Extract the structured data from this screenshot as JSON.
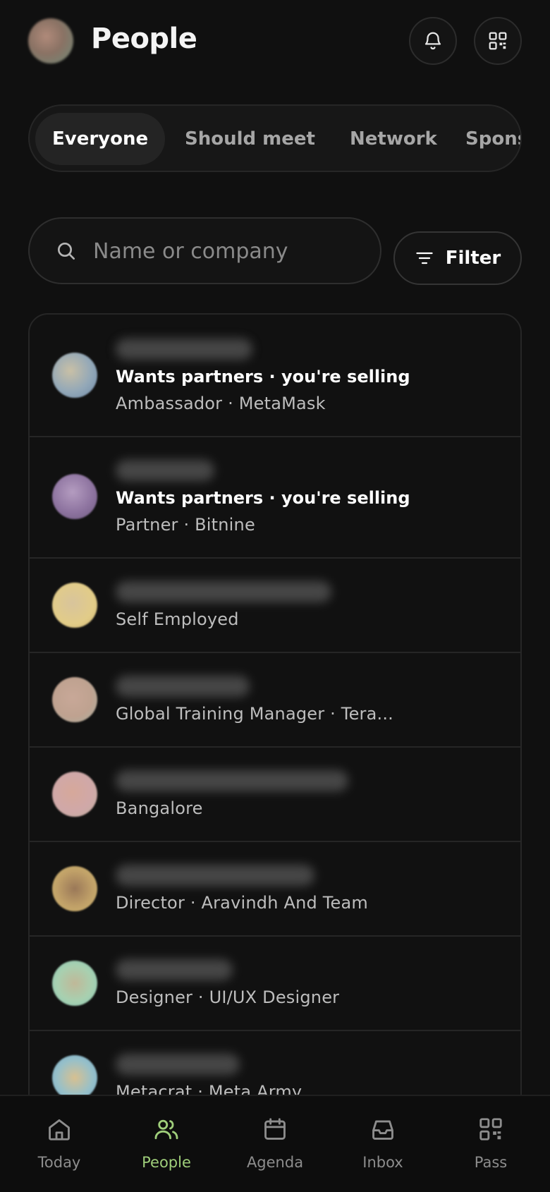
{
  "header": {
    "title": "People"
  },
  "tabs": [
    {
      "label": "Everyone",
      "active": true
    },
    {
      "label": "Should meet"
    },
    {
      "label": "Network"
    },
    {
      "label": "Sponsors"
    }
  ],
  "search": {
    "placeholder": "Name or company",
    "value": ""
  },
  "filter": {
    "label": "Filter"
  },
  "people": [
    {
      "intent": "Wants partners · you're selling",
      "detail": "Ambassador · MetaMask"
    },
    {
      "intent": "Wants partners · you're selling",
      "detail": "Partner · Bitnine"
    },
    {
      "detail": "Self Employed"
    },
    {
      "detail": "Global Training Manager · Tera..."
    },
    {
      "detail": "Bangalore"
    },
    {
      "detail": "Director · Aravindh And Team"
    },
    {
      "detail": "Designer · UI/UX Designer"
    },
    {
      "detail": "Metacrat · Meta Army"
    }
  ],
  "nav": [
    {
      "label": "Today",
      "icon": "home-icon"
    },
    {
      "label": "People",
      "icon": "people-icon",
      "active": true
    },
    {
      "label": "Agenda",
      "icon": "calendar-icon"
    },
    {
      "label": "Inbox",
      "icon": "inbox-icon"
    },
    {
      "label": "Pass",
      "icon": "qr-code-icon"
    }
  ],
  "colors": {
    "background": "#101010",
    "accent": "#9fce7a",
    "border": "#262626",
    "muted_text": "#bdbdbd"
  }
}
